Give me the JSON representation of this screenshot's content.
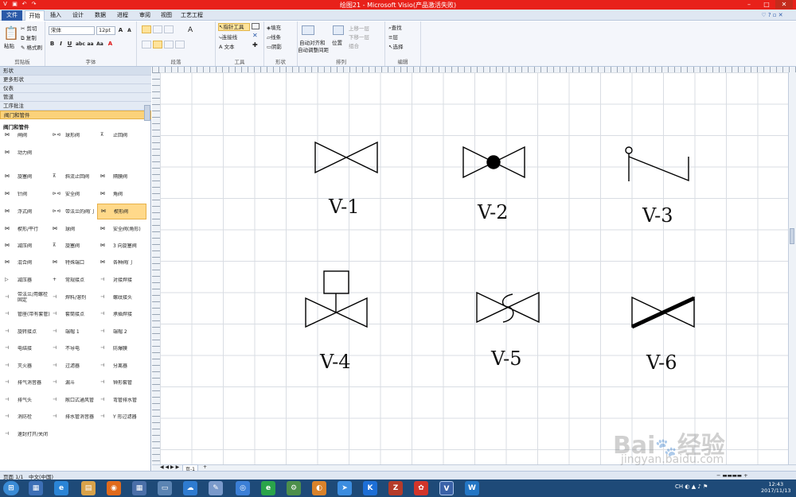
{
  "title": "绘图21 - Microsoft Visio(产品激活失败)",
  "tabs": [
    "文件",
    "开始",
    "插入",
    "设计",
    "数据",
    "进程",
    "审阅",
    "视图",
    "工艺工程"
  ],
  "ribbon": {
    "clipboard": {
      "label": "剪贴板",
      "paste": "粘贴",
      "cut": "剪切",
      "copy": "复制",
      "format_painter": "格式刷"
    },
    "font": {
      "label": "字体",
      "font_name": "宋体",
      "font_size": "12pt"
    },
    "paragraph": {
      "label": "段落"
    },
    "tools": {
      "label": "工具",
      "pointer": "指针工具",
      "connector": "连接线",
      "text": "文本"
    },
    "shape": {
      "label": "形状",
      "fill": "填充",
      "line": "线条",
      "shadow": "阴影"
    },
    "arrange": {
      "label": "排列",
      "auto_align": "自动对齐和",
      "auto_space": "自动调整间距",
      "position": "位置",
      "bring_forward": "上移一层",
      "send_backward": "下移一层",
      "group": "组合"
    },
    "editing": {
      "label": "编辑",
      "find": "查找",
      "layers": "层",
      "select": "选择"
    }
  },
  "shapes_panel": {
    "header": "形状",
    "categories": [
      "更多形状",
      "仪表",
      "管道",
      "工序批注",
      "阀门和管件"
    ],
    "section_title": "阀门和管件",
    "items": [
      "闸阀",
      "球形阀",
      "止回阀",
      "动力阀",
      "旋塞阀",
      "斜流止回阀",
      "隔膜阀",
      "针阀",
      "安全阀",
      "角阀",
      "浮式阀",
      "带法兰的阀门",
      "楔形阀",
      "楔形/平行",
      "球阀",
      "安全阀(角形)",
      "减压阀",
      "旋塞阀",
      "3 向旋塞阀",
      "混合阀",
      "特殊端口",
      "各种阀门",
      "减压器",
      "常规接点",
      "对接焊接",
      "带法兰/用螺栓固定",
      "焊料/溶剂",
      "螺纹接头",
      "管座(带有套管)",
      "套筒接点",
      "承插焊接",
      "旋转接点",
      "端帽 1",
      "端帽 2",
      "电结接",
      "不导电",
      "防爆膜",
      "灭火器",
      "过滤器",
      "分离器",
      "排气消音器",
      "漏斗",
      "钟形套管",
      "排气头",
      "敞口式通风管",
      "弯管排水管",
      "消防栓",
      "排水管消音器",
      "Y 形过滤器",
      "速封打开/关闭"
    ]
  },
  "canvas": {
    "labels": [
      "V-1",
      "V-2",
      "V-3",
      "V-4",
      "V-5",
      "V-6"
    ]
  },
  "page_tab": "页-1",
  "status": {
    "page": "页面 1/1",
    "language": "中文(中国)"
  },
  "taskbar": {
    "time": "12:43",
    "date": "2017/11/13"
  },
  "watermark": {
    "brand": "Bai",
    "brand_cn": "经验",
    "url": "jingyan.baidu.com"
  }
}
